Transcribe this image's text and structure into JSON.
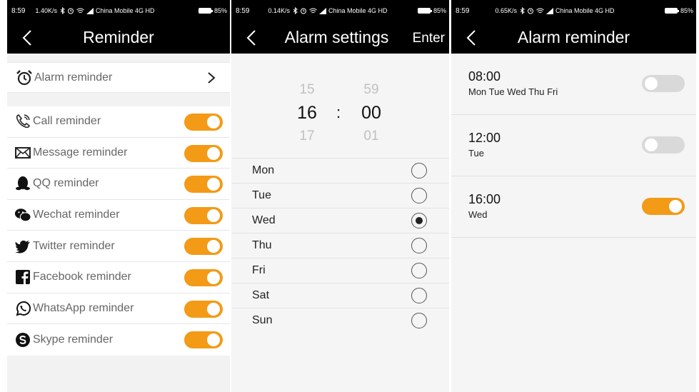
{
  "colors": {
    "accent": "#f39a16",
    "toggle_off": "#d9d9d9",
    "header_bg": "#000000",
    "bg": "#f2f2f2"
  },
  "screen1": {
    "status": {
      "time": "8:59",
      "info": "1.40K/s",
      "carrier": "China Mobile 4G HD",
      "battery": "85%"
    },
    "title": "Reminder",
    "alarm_row": {
      "label": "Alarm reminder",
      "icon": "alarm-clock-icon"
    },
    "items": [
      {
        "label": "Call reminder",
        "icon": "phone-icon",
        "on": true
      },
      {
        "label": "Message reminder",
        "icon": "envelope-icon",
        "on": true
      },
      {
        "label": "QQ reminder",
        "icon": "qq-penguin-icon",
        "on": true
      },
      {
        "label": "Wechat reminder",
        "icon": "wechat-icon",
        "on": true
      },
      {
        "label": "Twitter reminder",
        "icon": "twitter-icon",
        "on": true
      },
      {
        "label": "Facebook reminder",
        "icon": "facebook-icon",
        "on": true
      },
      {
        "label": "WhatsApp reminder",
        "icon": "whatsapp-icon",
        "on": true
      },
      {
        "label": "Skype reminder",
        "icon": "skype-icon",
        "on": true
      }
    ]
  },
  "screen2": {
    "status": {
      "time": "8:59",
      "info": "0.14K/s",
      "carrier": "China Mobile 4G HD",
      "battery": "85%"
    },
    "title": "Alarm settings",
    "action": "Enter",
    "hours": {
      "prev": "15",
      "current": "16",
      "next": "17"
    },
    "minutes": {
      "prev": "59",
      "current": "00",
      "next": "01"
    },
    "separator": ":",
    "days": [
      {
        "label": "Mon",
        "checked": false
      },
      {
        "label": "Tue",
        "checked": false
      },
      {
        "label": "Wed",
        "checked": true
      },
      {
        "label": "Thu",
        "checked": false
      },
      {
        "label": "Fri",
        "checked": false
      },
      {
        "label": "Sat",
        "checked": false
      },
      {
        "label": "Sun",
        "checked": false
      }
    ]
  },
  "screen3": {
    "status": {
      "time": "8:59",
      "info": "0.65K/s",
      "carrier": "China Mobile 4G HD",
      "battery": "85%"
    },
    "title": "Alarm reminder",
    "alarms": [
      {
        "time": "08:00",
        "days": "Mon Tue Wed Thu Fri",
        "on": false
      },
      {
        "time": "12:00",
        "days": "Tue",
        "on": false
      },
      {
        "time": "16:00",
        "days": "Wed",
        "on": true
      }
    ]
  }
}
